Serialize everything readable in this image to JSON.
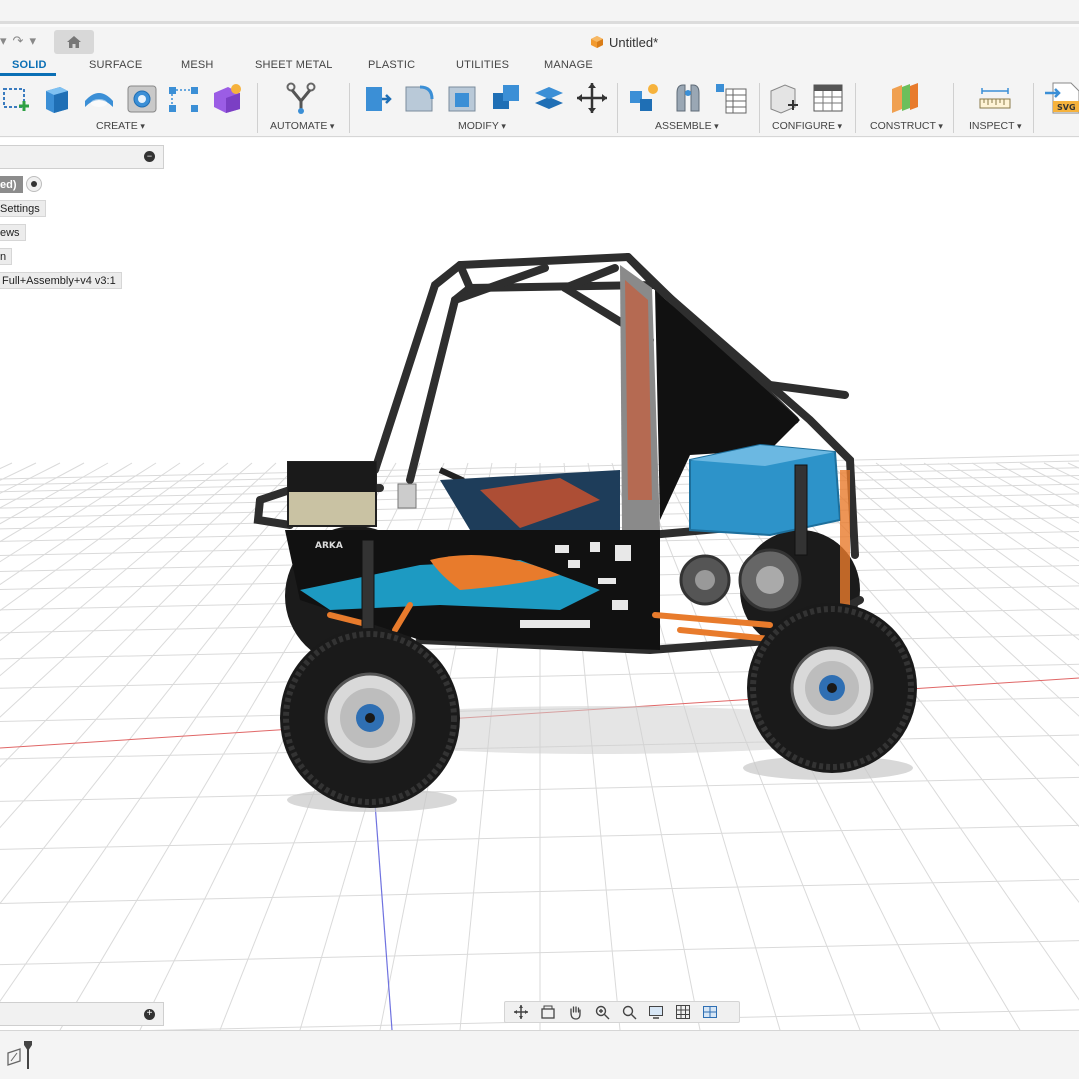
{
  "window": {
    "doc_title": "Untitled*",
    "doc_icon": "cube-icon"
  },
  "tabs": [
    {
      "label": "SOLID",
      "active": true
    },
    {
      "label": "SURFACE"
    },
    {
      "label": "MESH"
    },
    {
      "label": "SHEET METAL"
    },
    {
      "label": "PLASTIC"
    },
    {
      "label": "UTILITIES"
    },
    {
      "label": "MANAGE"
    }
  ],
  "ribbon": {
    "groups": [
      {
        "label": "CREATE"
      },
      {
        "label": "AUTOMATE"
      },
      {
        "label": "MODIFY"
      },
      {
        "label": "ASSEMBLE"
      },
      {
        "label": "CONFIGURE"
      },
      {
        "label": "CONSTRUCT"
      },
      {
        "label": "INSPECT"
      }
    ],
    "insert_badge": "SVG"
  },
  "browser": {
    "items": [
      {
        "label": "ed)",
        "active": true
      },
      {
        "label": "Settings"
      },
      {
        "label": "ews"
      },
      {
        "label": "n"
      },
      {
        "label": "Full+Assembly+v4 v3:1"
      }
    ]
  },
  "model": {
    "decal_brand": "ARKA",
    "colors": {
      "frame": "#2e2e2e",
      "tank": "#2d93c9",
      "accent": "#e87b2c",
      "hub": "#2f6fb3",
      "panel": "#111111"
    }
  },
  "colors": {
    "accent": "#0a6fb5",
    "axis_x": "#e05a5a",
    "axis_y": "#6f72e0"
  }
}
